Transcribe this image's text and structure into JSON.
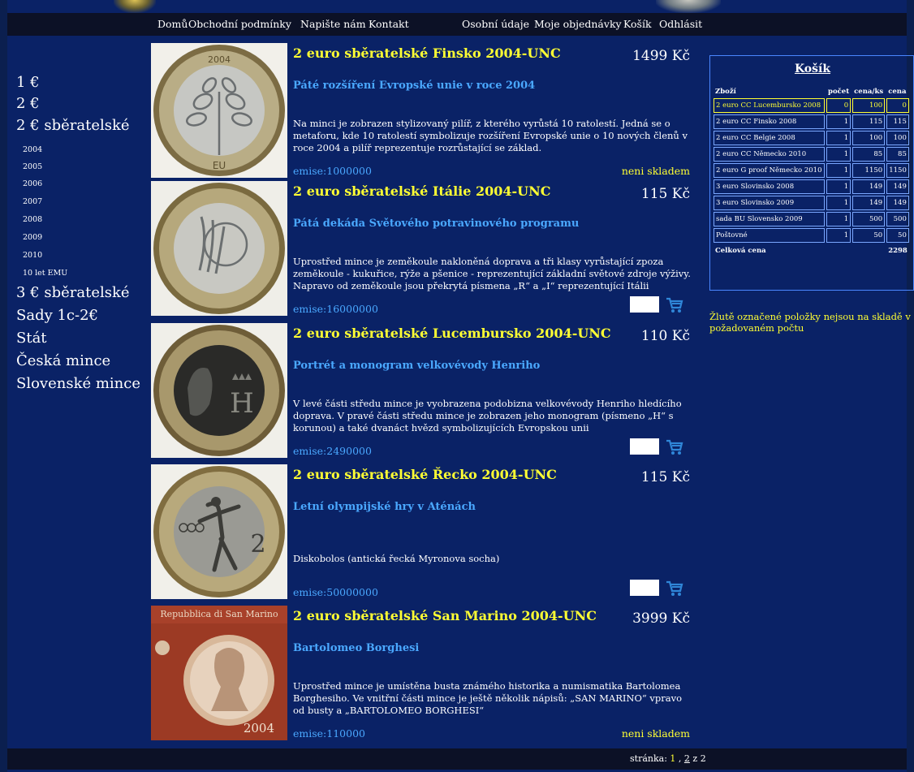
{
  "nav": {
    "home": "Domů",
    "terms": "Obchodní podmínky",
    "write": "Napište nám",
    "contact": "Kontakt",
    "personal": "Osobní údaje",
    "orders": "Moje objednávky",
    "cart": "Košík",
    "logout": "Odhlásit"
  },
  "menu": {
    "item1": "1 €",
    "item2": "2 €",
    "item3": "2 € sběratelské",
    "years": [
      "2004",
      "2005",
      "2006",
      "2007",
      "2008",
      "2009",
      "2010",
      "10 let EMU"
    ],
    "item4": "3 € sběratelské",
    "item5": "Sady 1c-2€",
    "item6": "Stát",
    "item7": "Česká mince",
    "item8": "Slovenské mince"
  },
  "products": [
    {
      "title": "2 euro sběratelské Finsko 2004-UNC",
      "price": "1499 Kč",
      "subtitle": "Páté rozšíření Evropské unie v roce 2004",
      "desc": "Na minci je zobrazen stylizovaný pilíř, z kterého vyrůstá 10 ratolestí. Jedná se o metaforu, kde 10 ratolestí symbolizuje rozšíření Evropské unie o 10 nových členů v roce 2004 a pilíř reprezentuje rozrůstající se základ.",
      "emise": "emise:1000000",
      "stock": "neni skladem",
      "coin_year": "2004",
      "coin_text": "EU"
    },
    {
      "title": "2 euro sběratelské Itálie 2004-UNC",
      "price": "115 Kč",
      "subtitle": "Pátá dekáda Světového potravinového programu",
      "desc": "Uprostřed mince je zeměkoule nakloněná doprava a tři klasy vyrůstající zpoza zeměkoule - kukuřice, rýže a pšenice - reprezentující základní světové zdroje výživy. Napravo od zeměkoule jsou překrytá písmena „R“ a „I“ reprezentující Itálii",
      "emise": "emise:16000000"
    },
    {
      "title": "2 euro sběratelské Lucembursko 2004-UNC",
      "price": "110 Kč",
      "subtitle": "Portrét a monogram velkovévody Henriho",
      "desc": "V levé části středu mince je vyobrazena podobizna velkovévody Henriho hledícího doprava. V pravé části středu mince je zobrazen jeho monogram (písmeno „H“ s korunou) a také dvanáct hvězd symbolizujících Evropskou unii",
      "emise": "emise:2490000",
      "coin_letter": "H"
    },
    {
      "title": "2 euro sběratelské Řecko 2004-UNC",
      "price": "115 Kč",
      "subtitle": "Letní olympijské hry v Aténách",
      "desc": "Diskobolos (antická řecká Myronova socha)",
      "emise": "emise:50000000",
      "coin_value": "2"
    },
    {
      "title": "2 euro sběratelské San Marino 2004-UNC",
      "price": "3999 Kč",
      "subtitle": "Bartolomeo Borghesi",
      "desc": "Uprostřed mince je umístěna busta známého historika a numismatika Bartolomea Borghesiho. Ve vnitřní části mince je ještě několik nápisů: „SAN MARINO“ vpravo od busty a „BARTOLOMEO BORGHESI“",
      "emise": "emise:110000",
      "stock": "neni skladem",
      "card_header": "Repubblica di San Marino",
      "card_year": "2004"
    }
  ],
  "cart": {
    "title": "Košík",
    "col_item": "Zboží",
    "col_qty": "počet",
    "col_unit": "cena/ks",
    "col_price": "cena",
    "rows": [
      {
        "item": "2 euro CC Lucembursko 2008",
        "qty": "0",
        "unit": "100",
        "price": "0",
        "warn": true
      },
      {
        "item": "2 euro CC Finsko 2008",
        "qty": "1",
        "unit": "115",
        "price": "115"
      },
      {
        "item": "2 euro CC Belgie 2008",
        "qty": "1",
        "unit": "100",
        "price": "100"
      },
      {
        "item": "2 euro CC Německo 2010",
        "qty": "1",
        "unit": "85",
        "price": "85"
      },
      {
        "item": "2 euro G proof Německo 2010",
        "qty": "1",
        "unit": "1150",
        "price": "1150"
      },
      {
        "item": "3 euro Slovinsko 2008",
        "qty": "1",
        "unit": "149",
        "price": "149"
      },
      {
        "item": "3 euro Slovinsko 2009",
        "qty": "1",
        "unit": "149",
        "price": "149"
      },
      {
        "item": "sada BU Slovensko 2009",
        "qty": "1",
        "unit": "500",
        "price": "500"
      },
      {
        "item": "Poštovné",
        "qty": "1",
        "unit": "50",
        "price": "50"
      }
    ],
    "total_label": "Celková cena",
    "total": "2298",
    "note": "Žlutě označené položky nejsou na skladě v požadovaném počtu"
  },
  "pager": {
    "label": "stránka:",
    "current": "1",
    "sep": ",",
    "next": "2",
    "suffix": "z 2"
  },
  "colors": {
    "background": "#0a2266",
    "bar": "#0c1126",
    "title_yellow": "#ffff33",
    "link_blue": "#4aa8ff"
  },
  "icons": {
    "cart": "cart-icon"
  }
}
